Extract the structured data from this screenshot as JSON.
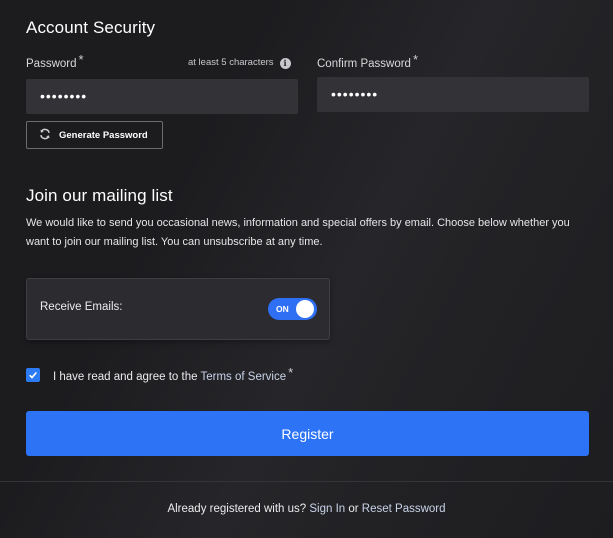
{
  "account_security": {
    "title": "Account Security",
    "password": {
      "label": "Password",
      "required_mark": "*",
      "hint": "at least 5 characters",
      "info_icon": "i",
      "value": "••••••••"
    },
    "confirm_password": {
      "label": "Confirm Password",
      "required_mark": "*",
      "value": "••••••••"
    },
    "generate_button": {
      "label": "Generate Password",
      "icon": "refresh-icon"
    }
  },
  "mailing_list": {
    "title": "Join our mailing list",
    "description_line1": "We would like to send you occasional news, information and special offers by email. Choose below whether you",
    "description_line2": "want to join our mailing list. You can unsubscribe at any time.",
    "receive_emails_label": "Receive Emails:",
    "toggle_state_label": "ON"
  },
  "terms": {
    "prefix": "I have read and agree to the ",
    "link_text": "Terms of Service",
    "required_mark": "*",
    "checked": true
  },
  "register_button": {
    "label": "Register"
  },
  "footer": {
    "prefix": "Already registered with us? ",
    "sign_in": "Sign In",
    "or": " or ",
    "reset_password": "Reset Password"
  },
  "colors": {
    "background": "#1f1f22",
    "input_bg": "#333337",
    "accent": "#2d73f6",
    "link": "#c9d3e8"
  }
}
